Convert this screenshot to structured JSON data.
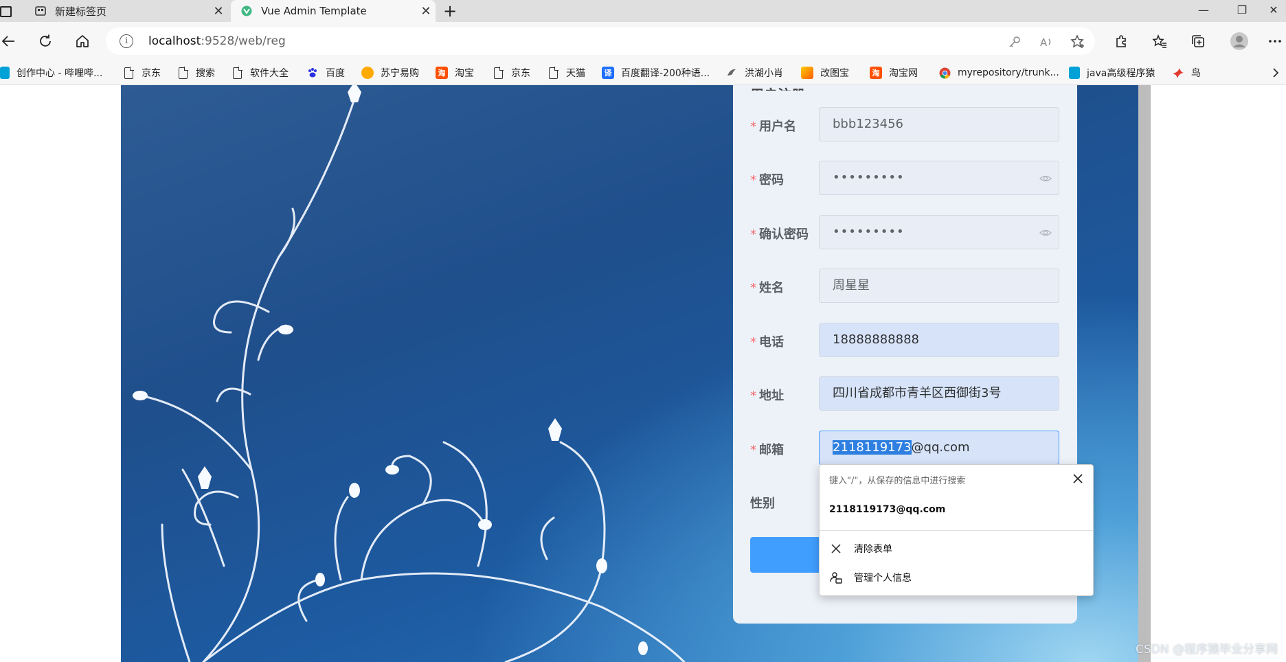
{
  "tabs": [
    {
      "title": "新建标签页",
      "close": "✕"
    },
    {
      "title": "Vue Admin Template",
      "close": "✕"
    }
  ],
  "window_controls": [
    "—",
    "❐",
    "✕"
  ],
  "address_bar": {
    "host": "localhost",
    "rest": ":9528/web/reg"
  },
  "bookmarks": [
    {
      "label": "创作中心 - 哔哩哔...",
      "icon": "bilibili-icon",
      "color": "#00a1d6"
    },
    {
      "label": "京东",
      "icon": "page-icon"
    },
    {
      "label": "搜索",
      "icon": "page-icon"
    },
    {
      "label": "软件大全",
      "icon": "page-icon"
    },
    {
      "label": "百度",
      "icon": "baidu-icon",
      "color": "#2932e1"
    },
    {
      "label": "苏宁易购",
      "icon": "suning-icon",
      "color": "#ffaa00"
    },
    {
      "label": "淘宝",
      "icon": "taobao-icon",
      "color": "#ff5000"
    },
    {
      "label": "京东",
      "icon": "page-icon"
    },
    {
      "label": "天猫",
      "icon": "page-icon"
    },
    {
      "label": "百度翻译-200种语...",
      "icon": "baidu-translate-icon",
      "color": "#1e6fff"
    },
    {
      "label": "洪湖小肖",
      "icon": "bird-icon"
    },
    {
      "label": "改图宝",
      "icon": "gaitubao-icon",
      "color": "#ff7a00"
    },
    {
      "label": "淘宝网",
      "icon": "taobao-icon",
      "color": "#ff5000"
    },
    {
      "label": "myrepository/trunk...",
      "icon": "chrome-icon"
    },
    {
      "label": "java高级程序猿",
      "icon": "bilibili-icon",
      "color": "#00a1d6"
    },
    {
      "label": "鸟",
      "icon": "bird-red-icon",
      "color": "#e23a2f"
    }
  ],
  "form": {
    "title": "用户注册",
    "required_mark": "*",
    "fields": [
      {
        "label": "用户名",
        "value": "bbb123456"
      },
      {
        "label": "密码",
        "value": "•••••••••"
      },
      {
        "label": "确认密码",
        "value": "•••••••••"
      },
      {
        "label": "姓名",
        "value": "周星星"
      },
      {
        "label": "电话",
        "value": "18888888888"
      },
      {
        "label": "地址",
        "value": "四川省成都市青羊区西御街3号"
      },
      {
        "label": "邮箱",
        "selected": "2118119173",
        "rest": "@qq.com"
      }
    ],
    "gender_label": "性别"
  },
  "autofill": {
    "hint": "键入\"/\"，从保存的信息中进行搜索",
    "suggestion": "2118119173@qq.com",
    "clear_form": "清除表单",
    "manage_info": "管理个人信息"
  },
  "watermark": "CSDN @程序猿毕业分享网",
  "colors": {
    "accent": "#409eff",
    "required": "#f56c6c",
    "selection": "#2e7fe0"
  }
}
